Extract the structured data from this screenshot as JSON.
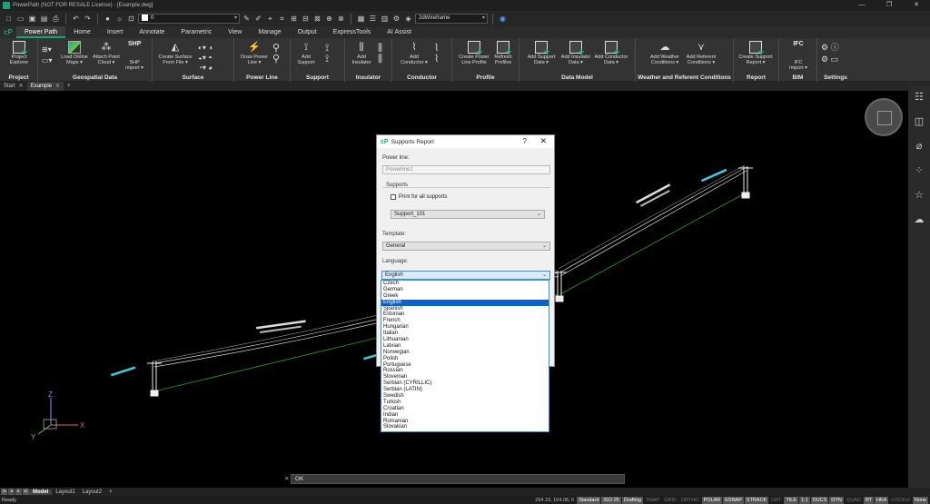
{
  "window": {
    "title": "PowerPath (NOT FOR RESALE License) - [Example.dwg]",
    "controls": [
      "—",
      "❐",
      "✕"
    ]
  },
  "quick_access": {
    "layer_value": "0",
    "visual_style": "2dWireframe"
  },
  "ribbon_tabs": [
    "Power Path",
    "Home",
    "Insert",
    "Annotate",
    "Parametric",
    "View",
    "Manage",
    "Output",
    "ExpressTools",
    "AI Assist"
  ],
  "ribbon_groups": [
    {
      "label": "Project",
      "buttons": [
        "Project\nExplorer"
      ]
    },
    {
      "label": "Geospatial Data",
      "buttons": [
        "Load Online\nMaps ▾",
        "Attach Point\nCloud ▾",
        "SHP\nImport ▾"
      ]
    },
    {
      "label": "Surface",
      "buttons": [
        "Create Surface\nFrom File ▾"
      ]
    },
    {
      "label": "Power Line",
      "buttons": [
        "Draw Power\nLine ▾"
      ]
    },
    {
      "label": "Support",
      "buttons": [
        "Add\nSupport"
      ]
    },
    {
      "label": "Insulator",
      "buttons": [
        "Add\nInsulator"
      ]
    },
    {
      "label": "Conductor",
      "buttons": [
        "Add\nConductor ▾"
      ]
    },
    {
      "label": "Profile",
      "buttons": [
        "Create Power\nLine Profile",
        "Refresh\nProfiles"
      ]
    },
    {
      "label": "Data Model",
      "buttons": [
        "Add Support\nData ▾",
        "Add Insulator\nData ▾",
        "Add Conductor\nData ▾"
      ]
    },
    {
      "label": "Weather and Referent Conditions",
      "buttons": [
        "Add Weather\nConditions ▾",
        "Add Referent\nConditions ▾"
      ]
    },
    {
      "label": "Report",
      "buttons": [
        "Create Support\nReport ▾"
      ]
    },
    {
      "label": "BIM",
      "buttons": [
        "IFC\nImport ▾"
      ]
    },
    {
      "label": "Settings",
      "buttons": []
    }
  ],
  "ribbon_extra": {
    "shp_icon_text": "SHP",
    "ifc_icon_text": "IFC"
  },
  "doc_tabs": {
    "start": "Start",
    "active": "Example",
    "close": "✕",
    "add": "+"
  },
  "dialog": {
    "title": "Supports Report",
    "help": "?",
    "close": "✕",
    "power_line_label": "Power line:",
    "power_line_value": "Powerline1",
    "supports_label": "Supports",
    "print_all_label": "Print for all supports",
    "support_value": "Support_101",
    "template_label": "Template:",
    "template_value": "General",
    "language_label": "Language:",
    "language_value": "English"
  },
  "languages": [
    "Czech",
    "German",
    "Greek",
    "English",
    "Spanish",
    "Estonian",
    "French",
    "Hungarian",
    "Italian",
    "Lithuanian",
    "Latvian",
    "Norwegian",
    "Polish",
    "Portuguese",
    "Russian",
    "Slovenian",
    "Serbian (CYRILLIC)",
    "Serbian (LATIN)",
    "Swedish",
    "Turkish",
    "Croatian",
    "Indian",
    "Romanian",
    "Slovakian"
  ],
  "selected_language_index": 3,
  "ucs": {
    "x": "X",
    "y": "Y",
    "z": "Z"
  },
  "command_line": {
    "text": "OK",
    "close": "✕"
  },
  "layout_tabs": {
    "model": "Model",
    "layout1": "Layout1",
    "layout2": "Layout2",
    "add": "+"
  },
  "status": {
    "ready": "Ready",
    "coords": "294.19, 164.08, 0",
    "items": [
      {
        "label": "Standard",
        "state": "on"
      },
      {
        "label": "ISO-25",
        "state": "on"
      },
      {
        "label": "Drafting",
        "state": "on"
      },
      {
        "label": "SNAP",
        "state": "off"
      },
      {
        "label": "GRID",
        "state": "off"
      },
      {
        "label": "ORTHO",
        "state": "off"
      },
      {
        "label": "POLAR",
        "state": "on"
      },
      {
        "label": "ESNAP",
        "state": "on"
      },
      {
        "label": "STRACK",
        "state": "on"
      },
      {
        "label": "LWT",
        "state": "off"
      },
      {
        "label": "TILE",
        "state": "on"
      },
      {
        "label": "1:1",
        "state": "on"
      },
      {
        "label": "DUCS",
        "state": "on"
      },
      {
        "label": "DYN",
        "state": "on"
      },
      {
        "label": "QUAD",
        "state": "off"
      },
      {
        "label": "RT",
        "state": "on"
      },
      {
        "label": "HKA",
        "state": "on"
      },
      {
        "label": "LOCKUI",
        "state": "off"
      },
      {
        "label": "None",
        "state": "on"
      }
    ]
  },
  "colors": {
    "accent": "#1aa37a",
    "select_blue": "#0a64c8",
    "ground_line": "#2f9e2f",
    "label_cyan": "#3ad0e0"
  }
}
